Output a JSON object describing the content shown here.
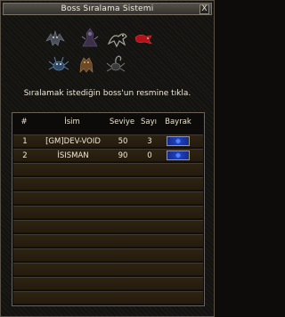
{
  "window": {
    "title": "Boss Sıralama Sistemi",
    "close_label": "X"
  },
  "instruction": "Sıralamak istediğin boss'un resmine tıkla.",
  "bosses": [
    {
      "icon": "gargoyle-boss-icon"
    },
    {
      "icon": "dark-mage-boss-icon"
    },
    {
      "icon": "skeleton-dragon-boss-icon"
    },
    {
      "icon": "red-dragon-boss-icon",
      "accent": "#c0141a"
    },
    {
      "icon": "ice-spider-boss-icon"
    },
    {
      "icon": "beast-boss-icon"
    },
    {
      "icon": "scorpion-boss-icon"
    }
  ],
  "table": {
    "headers": {
      "rank": "#",
      "name": "İsim",
      "level": "Seviye",
      "count": "Sayı",
      "flag": "Bayrak"
    },
    "rows": [
      {
        "rank": "1",
        "name": "[GM]DEV-VOID",
        "level": "50",
        "count": "3",
        "flag": "blue-flag-icon"
      },
      {
        "rank": "2",
        "name": "İSISMAN",
        "level": "90",
        "count": "0",
        "flag": "blue-flag-icon"
      }
    ],
    "empty_rows": 10
  },
  "colors": {
    "row_bg": "#2a2011",
    "flag_blue": "#1f3fb8",
    "accent_red": "#c0141a"
  }
}
